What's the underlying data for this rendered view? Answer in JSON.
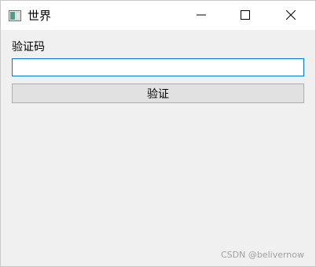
{
  "window": {
    "title": "世界",
    "app_icon": "window-app-icon",
    "controls": {
      "minimize_icon": "minimize-icon",
      "maximize_icon": "maximize-icon",
      "close_icon": "close-icon"
    }
  },
  "form": {
    "label": "验证码",
    "input_value": "",
    "button_label": "验证"
  },
  "watermark": "CSDN @belivernow",
  "colors": {
    "focus_border": "#0078d7",
    "button_bg": "#e1e1e1",
    "window_bg": "#f0f0f0",
    "watermark": "#a0a0a0"
  }
}
